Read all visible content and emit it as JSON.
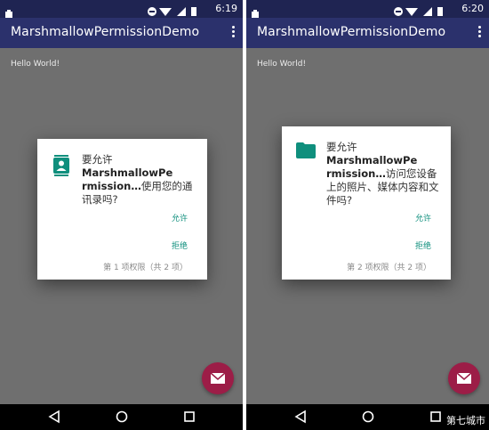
{
  "screens": [
    {
      "statusbar": {
        "time": "6:19"
      },
      "appbar": {
        "title": "MarshmallowPermissionDemo"
      },
      "content": {
        "hello": "Hello World!"
      },
      "dialog": {
        "icon": "contacts-icon",
        "msg_prefix": "要允许",
        "app_name": "MarshmallowPe rmission…",
        "msg_suffix": "使用您的通讯录吗?",
        "allow": "允许",
        "deny": "拒绝",
        "counter": "第 1 项权限（共 2 项）"
      }
    },
    {
      "statusbar": {
        "time": "6:20"
      },
      "appbar": {
        "title": "MarshmallowPermissionDemo"
      },
      "content": {
        "hello": "Hello World!"
      },
      "dialog": {
        "icon": "folder-icon",
        "msg_prefix": "要允许",
        "app_name": "MarshmallowPe rmission…",
        "msg_suffix": "访问您设备上的照片、媒体内容和文件吗?",
        "allow": "允许",
        "deny": "拒绝",
        "counter": "第 2 项权限（共 2 项）"
      }
    }
  ],
  "watermark": "第七城市",
  "colors": {
    "accent": "#0f8f7d",
    "fab": "#9c1d47",
    "appbar": "#2b316c",
    "statusbar": "#1f2452"
  }
}
